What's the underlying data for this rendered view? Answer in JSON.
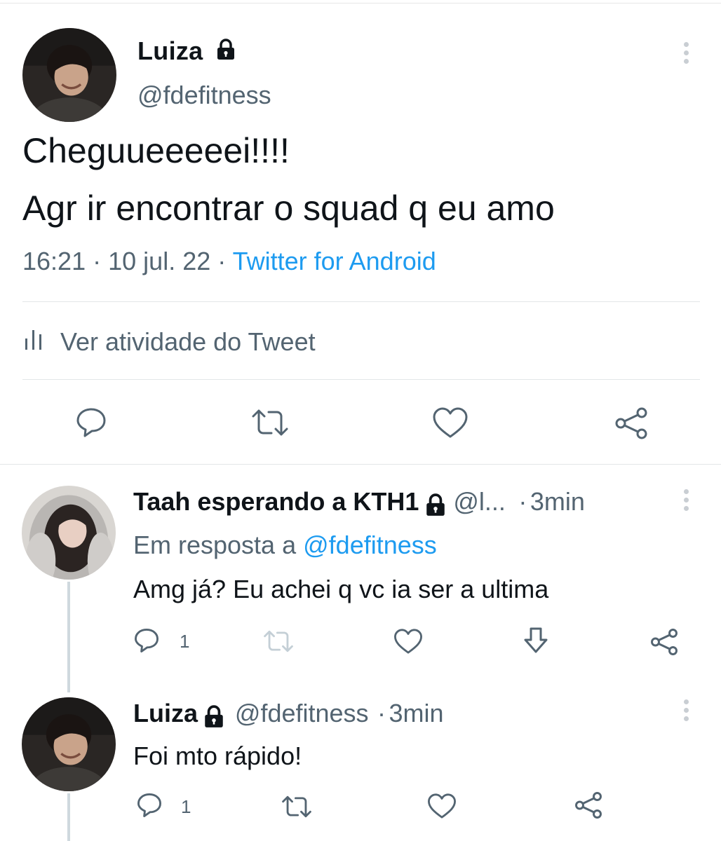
{
  "main_tweet": {
    "author_name": "Luiza",
    "author_handle": "@fdefitness",
    "text_line1": "Cheguueeeeei!!!!",
    "text_line2": "Agr ir encontrar o squad q eu amo",
    "time": "16:21",
    "date": "10 jul. 22",
    "separator": "·",
    "source": "Twitter for Android",
    "activity_label": "Ver atividade do Tweet"
  },
  "reply1": {
    "author_name": "Taah esperando a KTH1",
    "author_handle": "@l...",
    "separator": "·",
    "time": "3min",
    "in_reply_prefix": "Em resposta a",
    "in_reply_handle": "@fdefitness",
    "text": "Amg já? Eu achei q vc ia ser a ultima",
    "reply_count": "1"
  },
  "reply2": {
    "author_name": "Luiza",
    "author_handle": "@fdefitness",
    "separator": "·",
    "time": "3min",
    "text": "Foi mto rápido!",
    "reply_count": "1"
  },
  "icons": [
    "more-vertical-icon",
    "lock-icon",
    "activity-bars-icon",
    "reply-icon",
    "retweet-icon",
    "like-icon",
    "share-icon",
    "download-icon"
  ],
  "colors": {
    "link": "#1d9bf0",
    "secondary_text": "#536471",
    "primary_text": "#0f1419",
    "divider": "#e3e6e8",
    "thread_line": "#cfd9de"
  }
}
